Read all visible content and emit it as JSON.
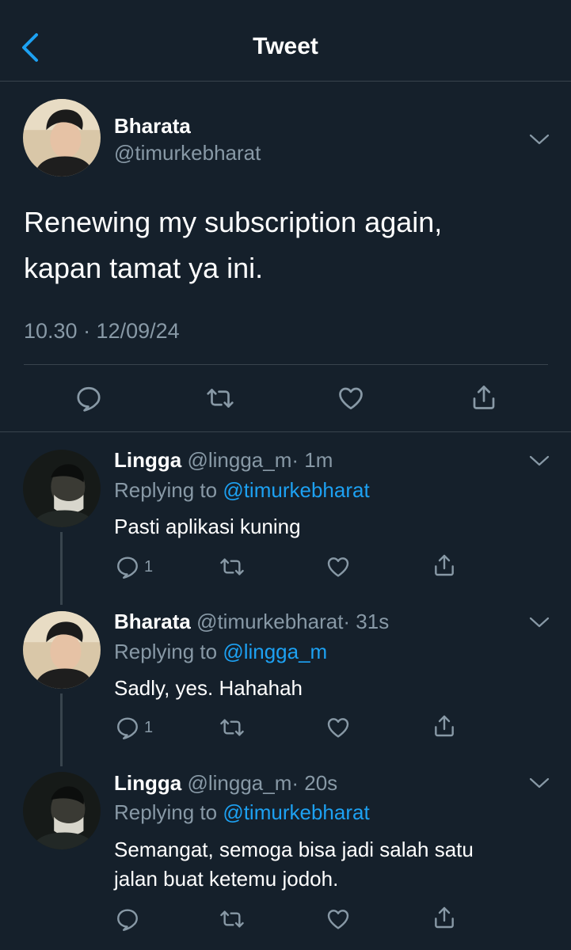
{
  "header": {
    "title": "Tweet"
  },
  "main_tweet": {
    "name": "Bharata",
    "handle": "@timurkebharat",
    "text_line1": "Renewing my subscription again,",
    "text_line2": "kapan tamat ya ini.",
    "timestamp": "10.30 · 12/09/24"
  },
  "replies": [
    {
      "name": "Lingga",
      "handle": "@lingga_m",
      "time": "· 1m",
      "replying_label": "Replying to",
      "replying_to": "@timurkebharat",
      "text": "Pasti aplikasi kuning",
      "reply_count": "1"
    },
    {
      "name": "Bharata",
      "handle": "@timurkebharat",
      "time": "· 31s",
      "replying_label": "Replying to",
      "replying_to": "@lingga_m",
      "text": "Sadly, yes. Hahahah",
      "reply_count": "1"
    },
    {
      "name": "Lingga",
      "handle": "@lingga_m",
      "time": "· 20s",
      "replying_label": "Replying to",
      "replying_to": "@timurkebharat",
      "text_line1": "Semangat, semoga bisa jadi salah satu",
      "text_line2": "jalan buat ketemu jodoh."
    }
  ],
  "colors": {
    "background": "#15202b",
    "divider": "#38444d",
    "secondary_text": "#8899a6",
    "accent": "#1da1f2"
  },
  "icons": [
    "back-chevron-icon",
    "chevron-down-icon",
    "reply-icon",
    "retweet-icon",
    "like-heart-icon",
    "share-icon"
  ]
}
